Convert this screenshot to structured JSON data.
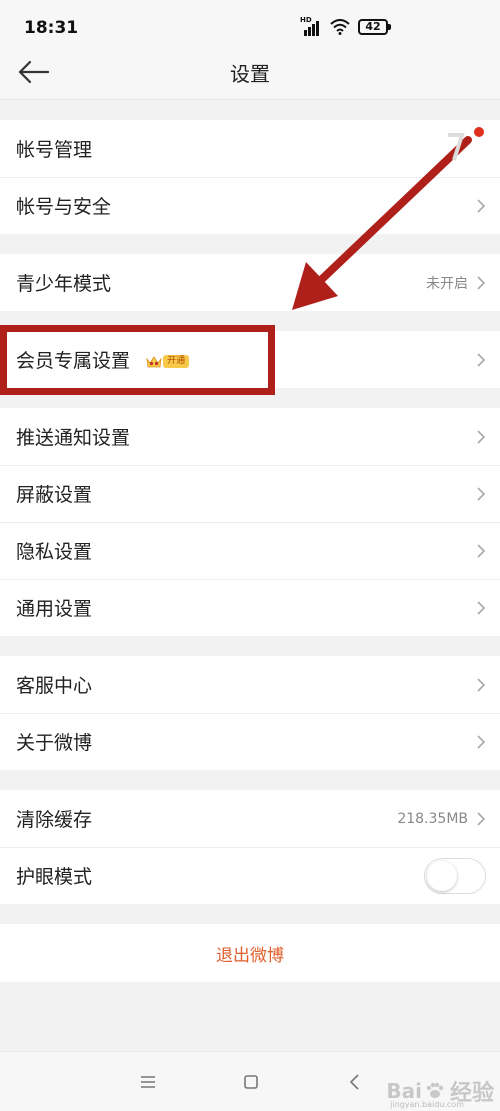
{
  "status_bar": {
    "time": "18:31",
    "hd": "HD",
    "battery": "42"
  },
  "nav": {
    "title": "设置"
  },
  "groups": {
    "account": {
      "manage": "帐号管理",
      "security": "帐号与安全"
    },
    "youth": {
      "label": "青少年模式",
      "value": "未开启"
    },
    "vip": {
      "label": "会员专属设置",
      "badge": "开通"
    },
    "settings": {
      "push": "推送通知设置",
      "block": "屏蔽设置",
      "privacy": "隐私设置",
      "general": "通用设置"
    },
    "help": {
      "service": "客服中心",
      "about": "关于微博"
    },
    "cache": {
      "label": "清除缓存",
      "value": "218.35MB"
    },
    "eye": {
      "label": "护眼模式"
    }
  },
  "logout": {
    "label": "退出微博"
  },
  "watermark": {
    "brand": "Bai",
    "sub": "经验",
    "url": "jingyan.baidu.com"
  },
  "colors": {
    "accent": "#e0602d",
    "highlight": "#b0201a"
  }
}
